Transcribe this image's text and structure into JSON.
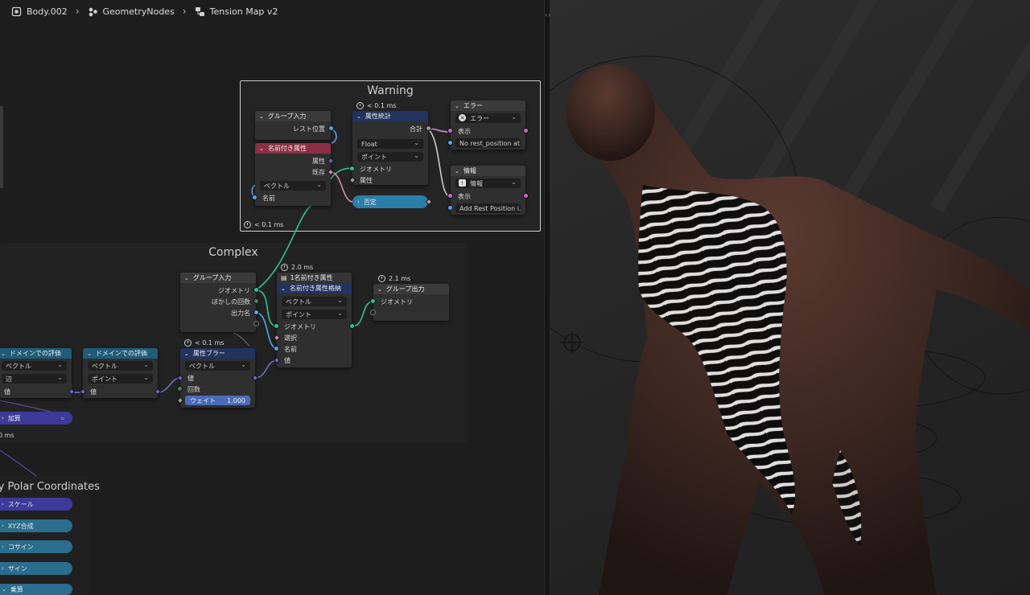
{
  "breadcrumb": {
    "items": [
      {
        "label": "Body.002",
        "icon": "object-icon"
      },
      {
        "label": "GeometryNodes",
        "icon": "modifier-icon"
      },
      {
        "label": "Tension Map v2",
        "icon": "node-tree-icon"
      }
    ],
    "separator": "›"
  },
  "frames": {
    "warning": {
      "title": "Warning",
      "timing": "< 0.1 ms"
    },
    "complex": {
      "title": "Complex"
    }
  },
  "nodes": {
    "group_input_warning": {
      "title": "グループ入力",
      "rest_position": "レスト位置"
    },
    "named_attr": {
      "title": "名前付き属性",
      "attribute": "属性",
      "exists": "既存",
      "type": "ベクトル",
      "name": "名前"
    },
    "attr_stats": {
      "timing": "< 0.1 ms",
      "title": "属性統計",
      "sum": "合計",
      "type": "Float",
      "domain": "ポイント",
      "geometry": "ジオメトリ",
      "attribute": "属性"
    },
    "negate": {
      "label": "否定"
    },
    "error": {
      "title": "エラー",
      "mode": "エラー",
      "show": "表示",
      "message": "No rest_position at..."
    },
    "info": {
      "title": "情報",
      "mode": "情報",
      "show": "表示",
      "message": "Add Rest Position i..."
    },
    "group_input_complex": {
      "title": "グループ入力",
      "geometry": "ジオメトリ",
      "blur_count": "ぼかしの回数",
      "output_name": "出力名"
    },
    "store_attr": {
      "timing": "2.0 ms",
      "subtitle": "1名前付き属性",
      "title": "名前付き属性格納",
      "type": "ベクトル",
      "domain": "ポイント",
      "geometry": "ジオメトリ",
      "selection": "選択",
      "name": "名前",
      "value": "値"
    },
    "group_output": {
      "timing": "2.1 ms",
      "title": "グループ出力",
      "geometry": "ジオメトリ"
    },
    "blur_attr": {
      "timing": "< 0.1 ms",
      "title": "属性ブラー",
      "type": "ベクトル",
      "value": "値",
      "iterations": "回数",
      "weight_label": "ウェイト",
      "weight_value": "1.000"
    },
    "eval_domain_1": {
      "title": "ドメインでの評価",
      "type": "ベクトル",
      "domain": "辺",
      "value": "値"
    },
    "eval_domain_2": {
      "title": "ドメインでの評価",
      "type": "ベクトル",
      "domain": "ポイント",
      "value": "値"
    },
    "add": {
      "label": "加算"
    },
    "ms_partial": "0 ms"
  },
  "polar": {
    "title": "ly Polar Coordinates",
    "items": [
      "スケール",
      "XYZ合成",
      "コサイン",
      "サイン",
      "乗算"
    ]
  },
  "colors": {
    "geometry_socket": "#2fc49a",
    "vector_socket": "#6363c7",
    "header_blue": "#22335e",
    "header_red": "#8d2f44",
    "negate_pill": "#2b7ea8",
    "weight_field": "#4a6bb8"
  }
}
